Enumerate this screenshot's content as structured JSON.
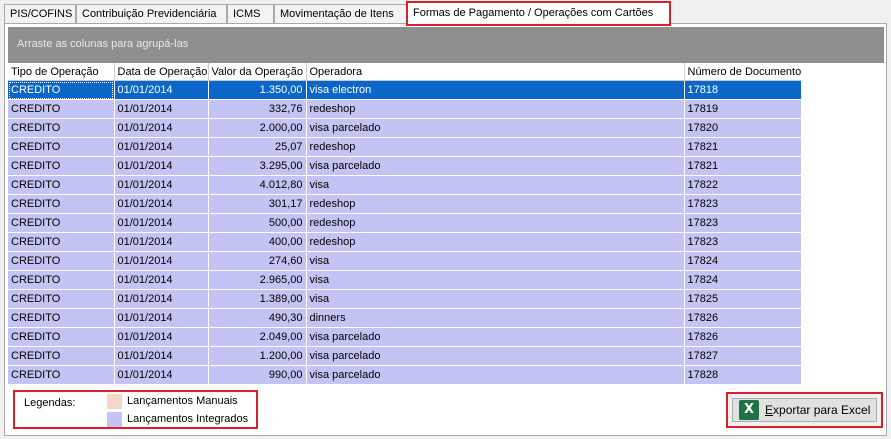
{
  "tabs": [
    {
      "label": "PIS/COFINS"
    },
    {
      "label": "Contribuição Previdenciária"
    },
    {
      "label": "ICMS"
    },
    {
      "label": "Movimentação de Itens"
    },
    {
      "label": "Formas de Pagamento / Operações com Cartões"
    }
  ],
  "active_tab": 4,
  "group_bar": "Arraste as colunas para agrupá-las",
  "columns": [
    "Tipo de Operação",
    "Data de Operação",
    "Valor da Operação",
    "Operadora",
    "Número de Documento"
  ],
  "rows": [
    [
      "CREDITO",
      "01/01/2014",
      "1.350,00",
      "visa electron",
      "17818"
    ],
    [
      "CREDITO",
      "01/01/2014",
      "332,76",
      "redeshop",
      "17819"
    ],
    [
      "CREDITO",
      "01/01/2014",
      "2.000,00",
      "visa parcelado",
      "17820"
    ],
    [
      "CREDITO",
      "01/01/2014",
      "25,07",
      "redeshop",
      "17821"
    ],
    [
      "CREDITO",
      "01/01/2014",
      "3.295,00",
      "visa parcelado",
      "17821"
    ],
    [
      "CREDITO",
      "01/01/2014",
      "4.012,80",
      "visa",
      "17822"
    ],
    [
      "CREDITO",
      "01/01/2014",
      "301,17",
      "redeshop",
      "17823"
    ],
    [
      "CREDITO",
      "01/01/2014",
      "500,00",
      "redeshop",
      "17823"
    ],
    [
      "CREDITO",
      "01/01/2014",
      "400,00",
      "redeshop",
      "17823"
    ],
    [
      "CREDITO",
      "01/01/2014",
      "274,60",
      "visa",
      "17824"
    ],
    [
      "CREDITO",
      "01/01/2014",
      "2.965,00",
      "visa",
      "17824"
    ],
    [
      "CREDITO",
      "01/01/2014",
      "1.389,00",
      "visa",
      "17825"
    ],
    [
      "CREDITO",
      "01/01/2014",
      "490,30",
      "dinners",
      "17826"
    ],
    [
      "CREDITO",
      "01/01/2014",
      "2.049,00",
      "visa parcelado",
      "17826"
    ],
    [
      "CREDITO",
      "01/01/2014",
      "1.200,00",
      "visa parcelado",
      "17827"
    ],
    [
      "CREDITO",
      "01/01/2014",
      "990,00",
      "visa parcelado",
      "17828"
    ]
  ],
  "selected_row": 0,
  "legend": {
    "label": "Legendas:",
    "manual": "Lançamentos Manuais",
    "integrated": "Lançamentos Integrados",
    "manual_color": "#f6d6c6",
    "integrated_color": "#c4c4f4"
  },
  "export": {
    "label_underlined": "E",
    "label_rest": "xportar para Excel",
    "icon": "excel-icon"
  }
}
